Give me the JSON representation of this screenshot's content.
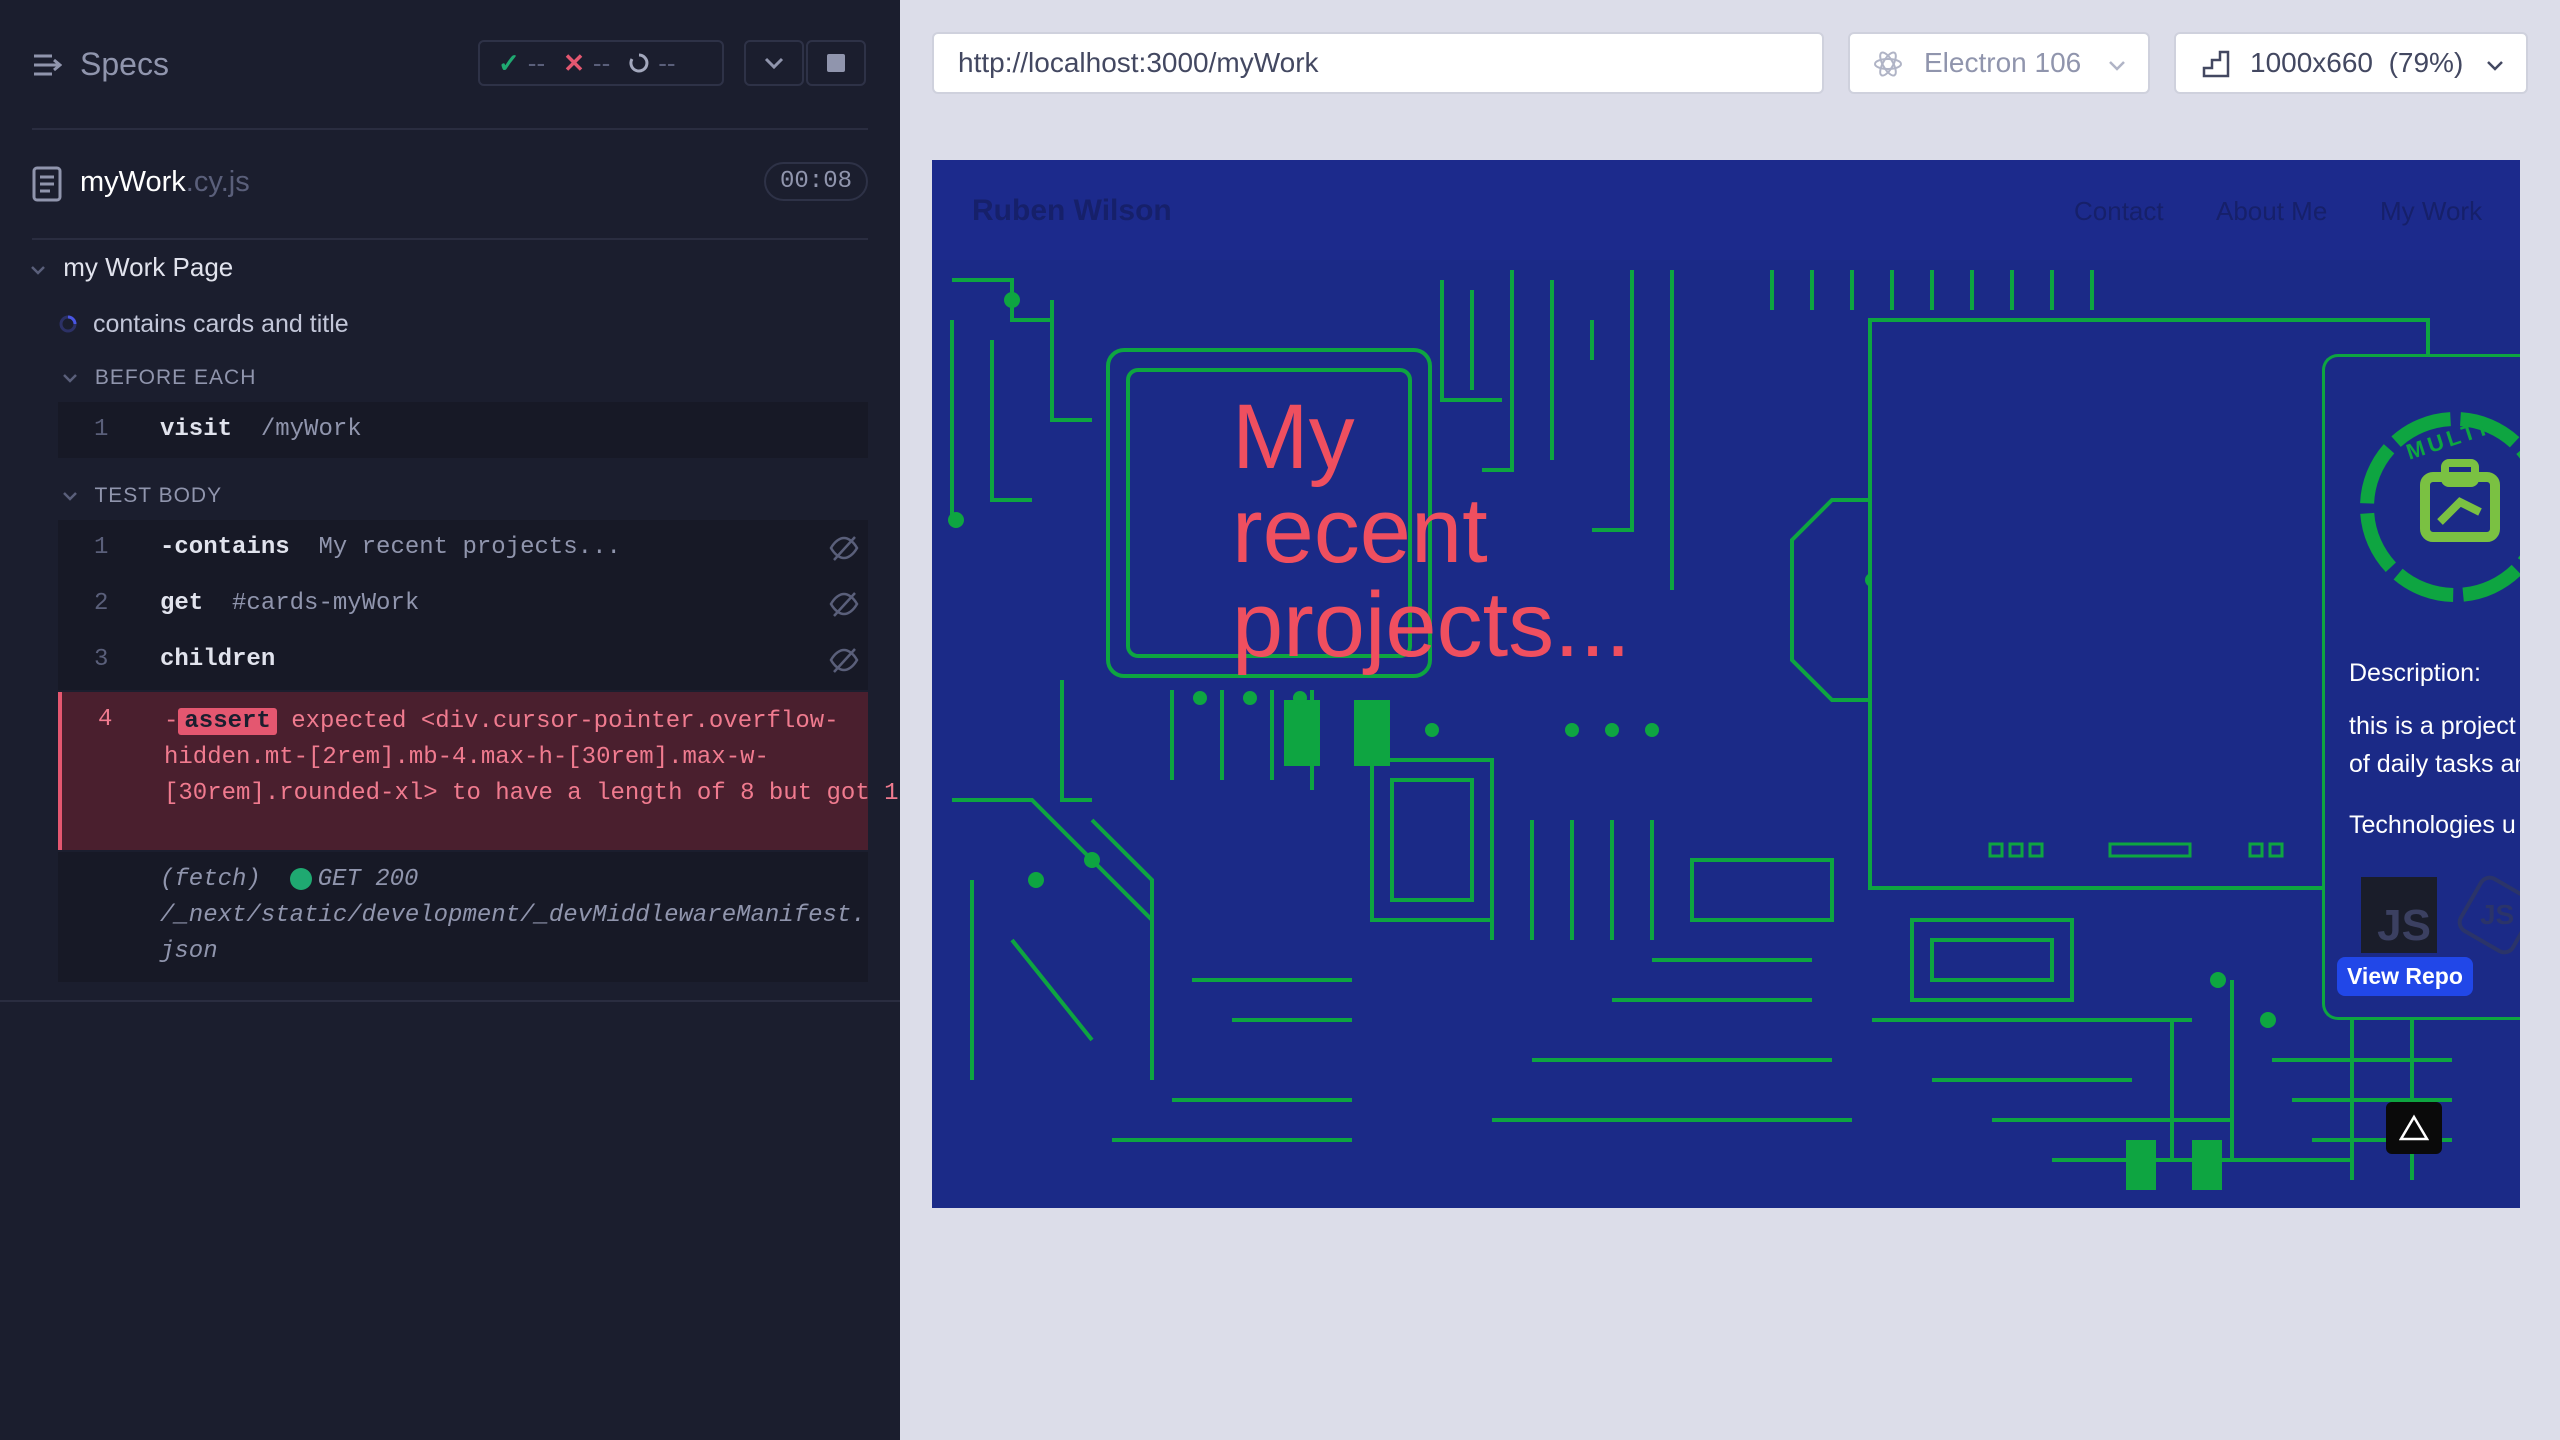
{
  "header": {
    "title": "Specs",
    "stats": {
      "passed": "--",
      "failed": "--",
      "pending": "--"
    }
  },
  "spec_file": {
    "name": "myWork",
    "ext": ".cy.js",
    "duration": "00:08"
  },
  "suite": {
    "title": "my Work Page"
  },
  "test": {
    "title": "contains cards and title"
  },
  "before_each": {
    "label": "BEFORE EACH",
    "commands": [
      {
        "num": "1",
        "name": "visit",
        "arg": "/myWork"
      }
    ]
  },
  "test_body": {
    "label": "TEST BODY",
    "commands": [
      {
        "num": "1",
        "name": "-contains",
        "arg": "My recent projects..."
      },
      {
        "num": "2",
        "name": "get",
        "arg": "#cards-myWork"
      },
      {
        "num": "3",
        "name": "children",
        "arg": ""
      }
    ],
    "error": {
      "num": "4",
      "prefix": "-",
      "badge": "assert",
      "message": " expected <div.cursor-pointer.overflow-hidden.mt-[2rem].mb-4.max-h-[30rem].max-w-[30rem].rounded-xl> to have a length of 8 but got 1"
    },
    "fetch": {
      "label": "(fetch)",
      "status": "GET 200",
      "path": "/_next/static/development/_devMiddlewareManifest.json"
    }
  },
  "browser": {
    "url": "http://localhost:3000/myWork",
    "engine": "Electron 106",
    "viewport": "1000x660",
    "zoom": "(79%)"
  },
  "app": {
    "brand": "Ruben Wilson",
    "nav": [
      "Contact",
      "About Me",
      "My Work"
    ],
    "hero": {
      "line1": "My",
      "line2": "recent",
      "line3": "projects..."
    },
    "card": {
      "badge_text": "MULTI",
      "description_heading": "Description:",
      "description_line1": "this is a project",
      "description_line2": "of daily tasks an",
      "technologies_heading": "Technologies u",
      "tech1": "JS",
      "tech2": "JS",
      "button": "View Repo"
    }
  },
  "colors": {
    "panel_bg": "#1b1e2e",
    "app_bg": "#1b2a87",
    "circuit": "#0ea541",
    "hero": "#ef4f5f",
    "error": "#e45770"
  },
  "icons": [
    "specs-icon",
    "check-icon",
    "x-icon",
    "spinner-icon",
    "chevron-down-icon",
    "stop-icon",
    "file-icon",
    "eye-slash-icon",
    "electron-icon",
    "viewport-icon",
    "warning-icon"
  ]
}
